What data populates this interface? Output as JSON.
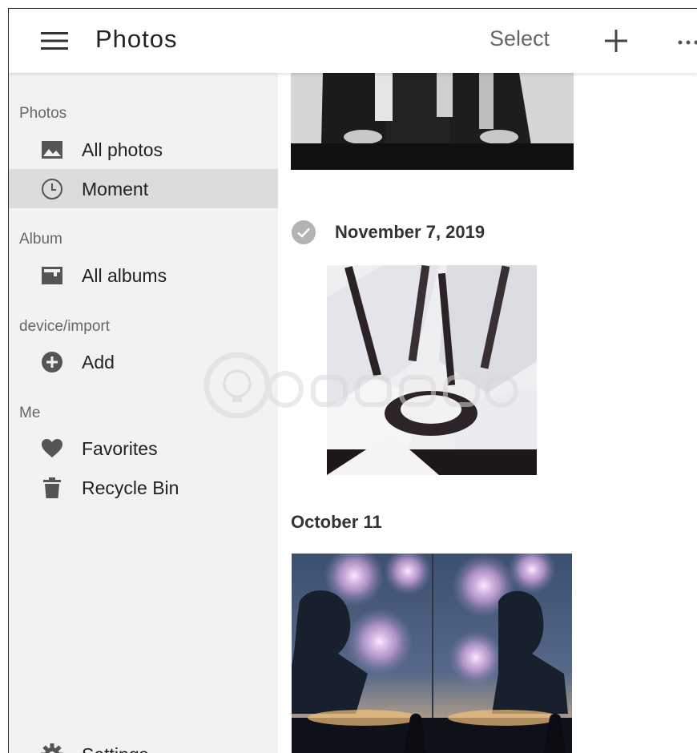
{
  "header": {
    "title": "Photos",
    "select_label": "Select",
    "menu_icon": "hamburger-menu-icon",
    "add_icon": "plus-icon",
    "more_icon": "more-dots-icon"
  },
  "sidebar": {
    "sections": [
      {
        "label": "Photos"
      },
      {
        "label": "Album"
      },
      {
        "label": "device/import"
      },
      {
        "label": "Me"
      }
    ],
    "items": [
      {
        "label": "All photos",
        "icon": "image-icon",
        "active": false
      },
      {
        "label": "Moment",
        "icon": "clock-icon",
        "active": true
      },
      {
        "label": "All albums",
        "icon": "album-icon",
        "active": false
      },
      {
        "label": "Add",
        "icon": "add-circle-icon",
        "active": false
      },
      {
        "label": "Favorites",
        "icon": "heart-icon",
        "active": false
      },
      {
        "label": "Recycle Bin",
        "icon": "trash-icon",
        "active": false
      }
    ],
    "settings_label": "Settings",
    "settings_icon": "gear-icon"
  },
  "content": {
    "groups": [
      {
        "date": "November 7, 2019"
      },
      {
        "date": "October 11"
      }
    ]
  },
  "colors": {
    "sidebar_bg": "#f2f2f2",
    "active_item_bg": "#dcdcdc",
    "text": "#222222",
    "muted_text": "#666666"
  }
}
